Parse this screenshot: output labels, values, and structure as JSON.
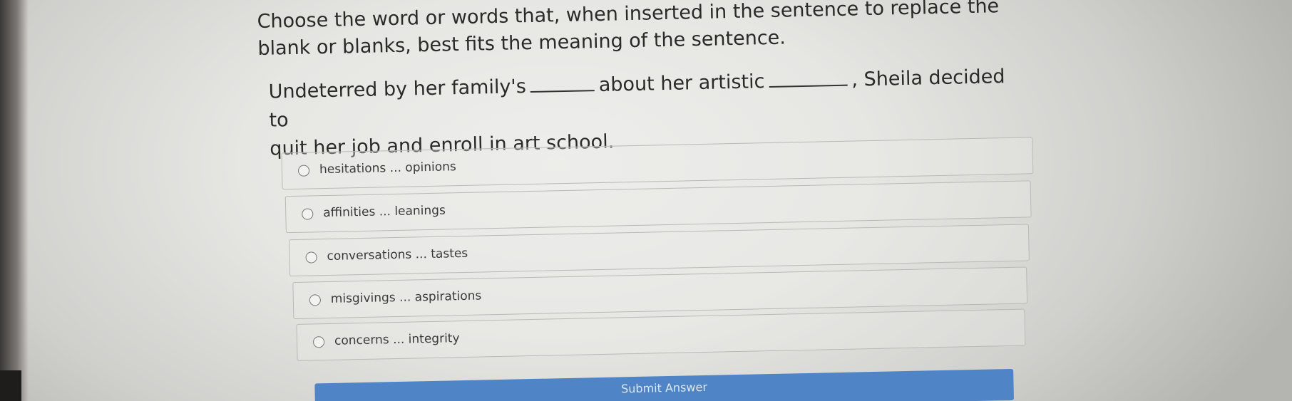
{
  "question": {
    "instruction_line1": "Choose the word or words that, when inserted in the sentence to replace the",
    "instruction_line2": "blank or blanks, best fits the meaning of the sentence.",
    "sentence_part1": "Undeterred by her family's",
    "sentence_part2": "about her artistic",
    "sentence_part3": ", Sheila decided to",
    "sentence_part4": "quit her job and enroll in art school."
  },
  "options": [
    {
      "label": "hesitations ... opinions"
    },
    {
      "label": "affinities ... leanings"
    },
    {
      "label": "conversations ... tastes"
    },
    {
      "label": "misgivings ... aspirations"
    },
    {
      "label": "concerns ... integrity"
    }
  ],
  "submit_label": "Submit Answer",
  "colors": {
    "accent": "#4f85c6",
    "text": "#2a2a2a"
  }
}
